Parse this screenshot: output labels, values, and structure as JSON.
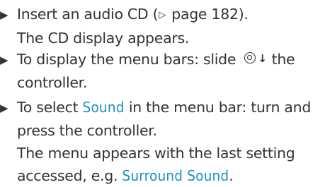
{
  "colors": {
    "text": "#333333",
    "menu_term": "#1a8fc6"
  },
  "icons": {
    "bullet": "triangle-right-icon",
    "page_ref": "page-reference-arrow-icon",
    "controller": "controller-slide-down-icon"
  },
  "steps": [
    {
      "action_before": "Insert an audio CD (",
      "page_ref_arrow": "▷",
      "action_after": " page 182).",
      "result": "The CD display appears."
    },
    {
      "action_line1_before": "To display the menu bars: slide ",
      "action_line1_after": " the",
      "action_line2": "controller."
    },
    {
      "action_line1_before": "To select ",
      "menu_term": "Sound",
      "action_line1_after": " in the menu bar: turn and",
      "action_line2": "press the controller.",
      "result_line1": "The menu appears with the last setting",
      "result_line2_before": "accessed, e.g. ",
      "result_menu_term": "Surround Sound",
      "result_line2_after": "."
    }
  ]
}
